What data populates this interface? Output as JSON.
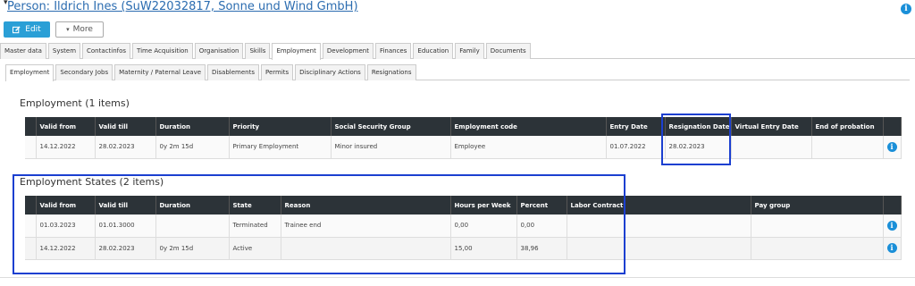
{
  "header": {
    "person_title": "Person: Ildrich Ines (SuW22032817, Sonne und Wind GmbH)",
    "caret": "▾",
    "info": "i"
  },
  "actions": {
    "edit_label": "Edit",
    "more_label": "More"
  },
  "main_tabs": [
    "Master data",
    "System",
    "Contactinfos",
    "Time Acquisition",
    "Organisation",
    "Skills",
    "Employment",
    "Development",
    "Finances",
    "Education",
    "Family",
    "Documents"
  ],
  "main_tab_active": "Employment",
  "sub_tabs": [
    "Employment",
    "Secondary Jobs",
    "Maternity / Paternal Leave",
    "Disablements",
    "Permits",
    "Disciplinary Actions",
    "Resignations"
  ],
  "sub_tab_active": "Employment",
  "employment": {
    "title": "Employment (1 items)",
    "columns": [
      "Valid from",
      "Valid till",
      "Duration",
      "Priority",
      "Social Security Group",
      "Employment code",
      "Entry Date",
      "Resignation Date",
      "Virtual Entry Date",
      "End of probation"
    ],
    "rows": [
      [
        "14.12.2022",
        "28.02.2023",
        "0y 2m 15d",
        "Primary Employment",
        "Minor insured",
        "Employee",
        "01.07.2022",
        "28.02.2023",
        "",
        ""
      ]
    ]
  },
  "states": {
    "title": "Employment States (2 items)",
    "columns": [
      "Valid from",
      "Valid till",
      "Duration",
      "State",
      "Reason",
      "Hours per Week",
      "Percent",
      "Labor Contract",
      "Pay group"
    ],
    "rows": [
      [
        "01.03.2023",
        "01.01.3000",
        "",
        "Terminated",
        "Trainee end",
        "0,00",
        "0,00",
        "",
        ""
      ],
      [
        "14.12.2022",
        "28.02.2023",
        "0y 2m 15d",
        "Active",
        "",
        "15,00",
        "38,96",
        "",
        ""
      ]
    ]
  },
  "colors": {
    "accent": "#2a9fd6",
    "header_bg": "#2c3338",
    "highlight": "#1b3fd0",
    "link": "#2b6cb0"
  }
}
